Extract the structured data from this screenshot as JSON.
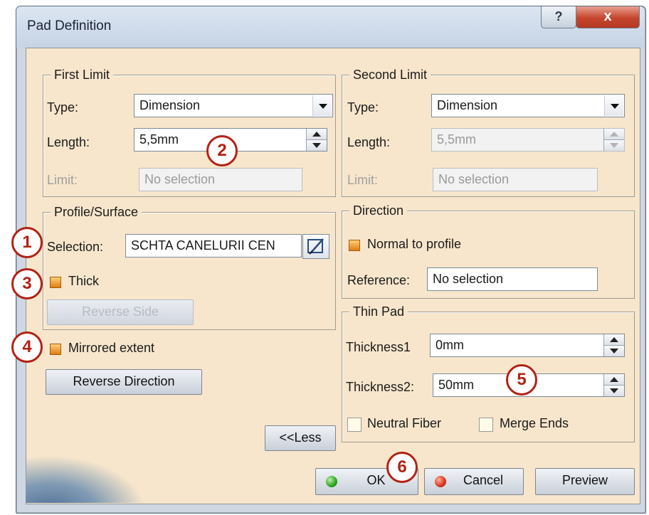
{
  "window": {
    "title": "Pad Definition",
    "help_glyph": "?",
    "close_glyph": "x"
  },
  "first_limit": {
    "legend": "First Limit",
    "type_label": "Type:",
    "type_value": "Dimension",
    "length_label": "Length:",
    "length_value": "5,5mm",
    "limit_label": "Limit:",
    "limit_value": "No selection"
  },
  "second_limit": {
    "legend": "Second Limit",
    "type_label": "Type:",
    "type_value": "Dimension",
    "length_label": "Length:",
    "length_value": "5,5mm",
    "limit_label": "Limit:",
    "limit_value": "No selection"
  },
  "profile": {
    "legend": "Profile/Surface",
    "selection_label": "Selection:",
    "selection_value": "SCHTA CANELURII CEN",
    "thick_label": "Thick",
    "thick_checked": true,
    "reverse_side_label": "Reverse Side"
  },
  "mirrored": {
    "label": "Mirrored extent",
    "checked": true
  },
  "reverse_direction_label": "Reverse Direction",
  "less_label": "<<Less",
  "direction": {
    "legend": "Direction",
    "normal_label": "Normal to profile",
    "normal_checked": true,
    "reference_label": "Reference:",
    "reference_value": "No selection"
  },
  "thin_pad": {
    "legend": "Thin Pad",
    "thickness1_label": "Thickness1",
    "thickness1_value": "0mm",
    "thickness2_label": "Thickness2:",
    "thickness2_value": "50mm",
    "neutral_fiber_label": "Neutral Fiber",
    "neutral_fiber_checked": false,
    "merge_ends_label": "Merge Ends",
    "merge_ends_checked": false
  },
  "buttons": {
    "ok": "OK",
    "cancel": "Cancel",
    "preview": "Preview"
  },
  "callouts": [
    "1",
    "2",
    "3",
    "4",
    "5",
    "6"
  ],
  "colors": {
    "panel": "#f7e6cc",
    "callout": "#b22214",
    "checkbox_on": "#e07d14"
  }
}
